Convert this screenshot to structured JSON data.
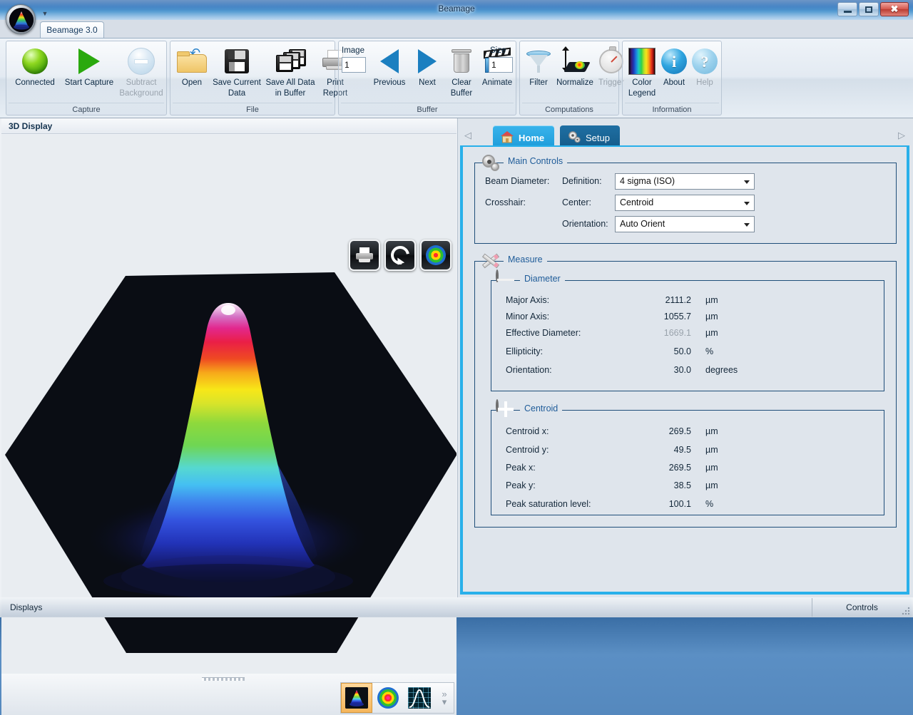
{
  "window": {
    "title": "Beamage",
    "minimize_label": "Minimize",
    "maximize_label": "Maximize",
    "close_label": "Close",
    "app_icon": "beam-3d-orb-icon",
    "quick_access_arrow": "chevron-down-icon"
  },
  "ribbon": {
    "tab_label": "Beamage 3.0",
    "groups": [
      {
        "name": "Capture",
        "title": "Capture",
        "items": [
          {
            "label": "Connected",
            "icon": "green-status-ball-icon",
            "disabled": false
          },
          {
            "label": "Start Capture",
            "icon": "play-triangle-icon",
            "disabled": false
          },
          {
            "label": "Subtract\nBackground",
            "label1": "Subtract",
            "label2": "Background",
            "icon": "subtract-background-icon",
            "disabled": true
          }
        ]
      },
      {
        "name": "File",
        "title": "File",
        "items": [
          {
            "label": "Open",
            "icon": "open-folder-icon",
            "disabled": false
          },
          {
            "label1": "Save Current",
            "label2": "Data",
            "icon": "floppy-disk-icon",
            "disabled": false
          },
          {
            "label1": "Save All Data",
            "label2": "in Buffer",
            "icon": "multiple-disks-icon",
            "disabled": false
          },
          {
            "label1": "Print",
            "label2": "Report",
            "icon": "printer-icon",
            "disabled": false
          }
        ]
      },
      {
        "name": "Buffer",
        "title": "Buffer",
        "image_field_label": "Image",
        "image_field_value": "1",
        "size_field_label": "Size",
        "size_field_value": "1",
        "items": [
          {
            "label": "Previous",
            "icon": "triangle-left-icon",
            "disabled": false
          },
          {
            "label": "Next",
            "icon": "triangle-right-icon",
            "disabled": false
          },
          {
            "label1": "Clear",
            "label2": "Buffer",
            "icon": "trash-can-icon",
            "disabled": false
          },
          {
            "label": "Animate",
            "icon": "clapperboard-icon",
            "disabled": false
          }
        ]
      },
      {
        "name": "Computations",
        "title": "Computations",
        "items": [
          {
            "label": "Filter",
            "icon": "funnel-icon",
            "disabled": false
          },
          {
            "label": "Normalize",
            "icon": "normalize-beam-icon",
            "disabled": false
          },
          {
            "label": "Trigger",
            "icon": "stopwatch-icon",
            "disabled": true
          }
        ]
      },
      {
        "name": "Information",
        "title": "Information",
        "items": [
          {
            "label1": "Color",
            "label2": "Legend",
            "icon": "color-spectrum-icon",
            "disabled": false
          },
          {
            "label": "About",
            "icon": "info-circle-icon",
            "disabled": false
          },
          {
            "label": "Help",
            "icon": "question-circle-icon",
            "disabled": true
          }
        ]
      }
    ]
  },
  "display": {
    "header_title": "3D Display",
    "view_tools": [
      {
        "name": "print-view-button",
        "icon": "printer-icon"
      },
      {
        "name": "rotate-view-button",
        "icon": "rotate-arrows-icon"
      },
      {
        "name": "colormap-view-button",
        "icon": "bullseye-colormap-icon"
      }
    ],
    "mode_tools": [
      {
        "name": "mode-3d-button",
        "icon": "3d-surface-icon",
        "active": true
      },
      {
        "name": "mode-2d-button",
        "icon": "2d-bullseye-icon",
        "active": false
      },
      {
        "name": "mode-graph-button",
        "icon": "profile-graph-icon",
        "active": false
      }
    ],
    "overflow_label": "»",
    "overflow_chevron": "chevron-down-icon"
  },
  "chart_data": {
    "type": "surface",
    "title": "3D Display",
    "description": "3D rainbow-colormap Gaussian beam profile rendered on a dark parallelogram base plane",
    "colormap": [
      "#05060d",
      "#1b1f8a",
      "#2a3fd8",
      "#3f86ee",
      "#45c8f0",
      "#55d7b5",
      "#74d84a",
      "#b9e22b",
      "#f5e319",
      "#f5a618",
      "#ee4422",
      "#e8257f",
      "#e06ac8",
      "#f3c8e8",
      "#ffffff"
    ],
    "background": "#e9edf1",
    "plane_color": "#0a0d14",
    "peak_value": 100.1,
    "peak_units": "%"
  },
  "panel": {
    "tabs": [
      {
        "label": "Home",
        "icon": "home-icon",
        "active": true
      },
      {
        "label": "Setup",
        "icon": "gears-icon",
        "active": false
      }
    ],
    "nav_prev_icon": "triangle-left-icon",
    "nav_next_icon": "triangle-right-icon",
    "main_controls": {
      "legend": "Main Controls",
      "icon": "gears-icon",
      "rows": [
        {
          "label_left": "Beam Diameter:",
          "label_right": "Definition:",
          "value": "4 sigma (ISO)"
        },
        {
          "label_left": "Crosshair:",
          "label_right": "Center:",
          "value": "Centroid"
        },
        {
          "label_left": "",
          "label_right": "Orientation:",
          "value": "Auto Orient"
        }
      ]
    },
    "measure": {
      "legend": "Measure",
      "icon": "pencils-icon",
      "diameter": {
        "legend": "Diameter",
        "icon": "diameter-bullseye-icon",
        "rows": [
          {
            "label": "Major Axis:",
            "value": "2111.2",
            "unit": "µm",
            "dim": false
          },
          {
            "label": "Minor Axis:",
            "value": "1055.7",
            "unit": "µm",
            "dim": false
          },
          {
            "label": "Effective Diameter:",
            "value": "1669.1",
            "unit": "µm",
            "dim": true
          },
          {
            "label": "Ellipticity:",
            "value": "50.0",
            "unit": "%",
            "dim": false
          },
          {
            "label": "Orientation:",
            "value": "30.0",
            "unit": "degrees",
            "dim": false
          }
        ]
      },
      "centroid": {
        "legend": "Centroid",
        "icon": "centroid-crosshair-icon",
        "rows": [
          {
            "label": "Centroid x:",
            "value": "269.5",
            "unit": "µm",
            "dim": false
          },
          {
            "label": "Centroid y:",
            "value": "49.5",
            "unit": "µm",
            "dim": false
          },
          {
            "label": "Peak x:",
            "value": "269.5",
            "unit": "µm",
            "dim": false
          },
          {
            "label": "Peak y:",
            "value": "38.5",
            "unit": "µm",
            "dim": false
          },
          {
            "label": "Peak saturation level:",
            "value": "100.1",
            "unit": "%",
            "dim": false
          }
        ]
      }
    }
  },
  "statusbar": {
    "left_label": "Displays",
    "right_label": "Controls"
  },
  "colors": {
    "accent": "#29b0ea",
    "titlebar": "#2e75bd",
    "group_border": "#1f4e79",
    "legend_text": "#1f5c99",
    "panel_bg": "#dfe5ec"
  }
}
